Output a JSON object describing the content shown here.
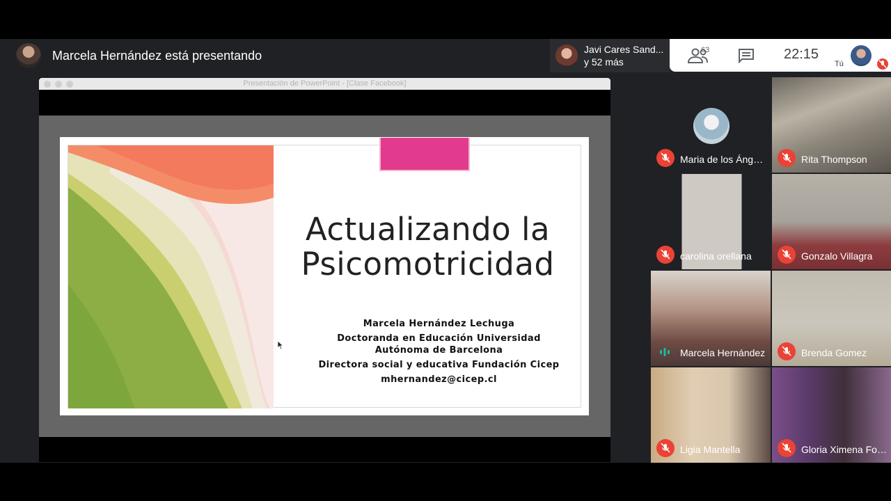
{
  "presenter": {
    "text": "Marcela Hernández está presentando"
  },
  "notification": {
    "line1": "Javi Cares Sand...",
    "line2": "y 52 más"
  },
  "controls": {
    "people_count": "63",
    "time": "22:15",
    "me_label": "Tú"
  },
  "share": {
    "window_title": "Presentación de PowerPoint - [Clase Facebook]"
  },
  "slide": {
    "title_line1": "Actualizando la",
    "title_line2": "Psicomotricidad",
    "info_name": "Marcela Hernández Lechuga",
    "info_degree": "Doctoranda en Educación Universidad Autónoma de Barcelona",
    "info_role": "Directora social y educativa Fundación Cicep",
    "info_email": "mhernandez@cicep.cl"
  },
  "participants": [
    {
      "name": "Maria de los Ángel...",
      "muted": true
    },
    {
      "name": "Rita Thompson",
      "muted": true
    },
    {
      "name": "carolina orellana",
      "muted": true
    },
    {
      "name": "Gonzalo Villagra",
      "muted": true
    },
    {
      "name": "Marcela Hernández",
      "muted": false,
      "speaking": true
    },
    {
      "name": "Brenda Gomez",
      "muted": true
    },
    {
      "name": "Ligia Mantella",
      "muted": true
    },
    {
      "name": "Gloria Ximena Folc...",
      "muted": true
    }
  ],
  "colors": {
    "mute_red": "#ea4335",
    "meet_bg": "#202124",
    "pink_accent": "#e23b8e",
    "speaking_teal": "#1db9a0"
  }
}
